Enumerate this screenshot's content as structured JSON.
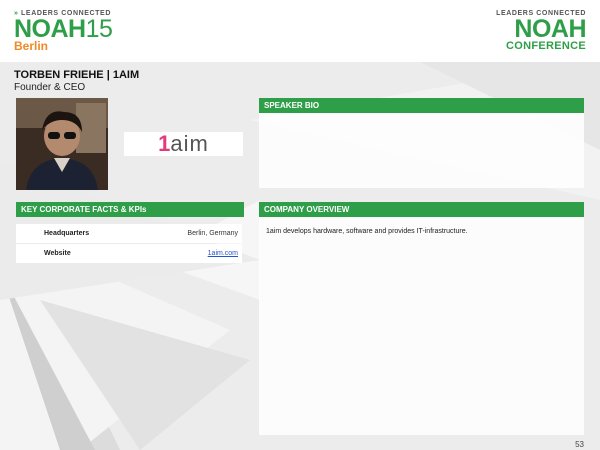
{
  "header": {
    "left_logo": {
      "tagline": "LEADERS CONNECTED",
      "brand": "NOAH",
      "edition": "15",
      "city": "Berlin"
    },
    "right_logo": {
      "tagline": "LEADERS CONNECTED",
      "brand": "NOAH",
      "subtitle": "CONFERENCE"
    }
  },
  "speaker": {
    "name": "TORBEN FRIEHE | 1AIM",
    "role": "Founder & CEO"
  },
  "company_logo": {
    "number": "1",
    "word": "aim"
  },
  "sections": {
    "bio_title": "SPEAKER BIO",
    "kpi_title": "KEY CORPORATE FACTS & KPIs",
    "overview_title": "COMPANY OVERVIEW"
  },
  "kpis": [
    {
      "label": "Headquarters",
      "value": "Berlin, Germany"
    },
    {
      "label": "Website",
      "value": "1aim.com"
    }
  ],
  "overview_text": "1aim develops hardware, software and provides IT-infrastructure.",
  "page_number": "53",
  "colors": {
    "brand_green": "#2f9e49",
    "accent_orange": "#f08a24"
  }
}
